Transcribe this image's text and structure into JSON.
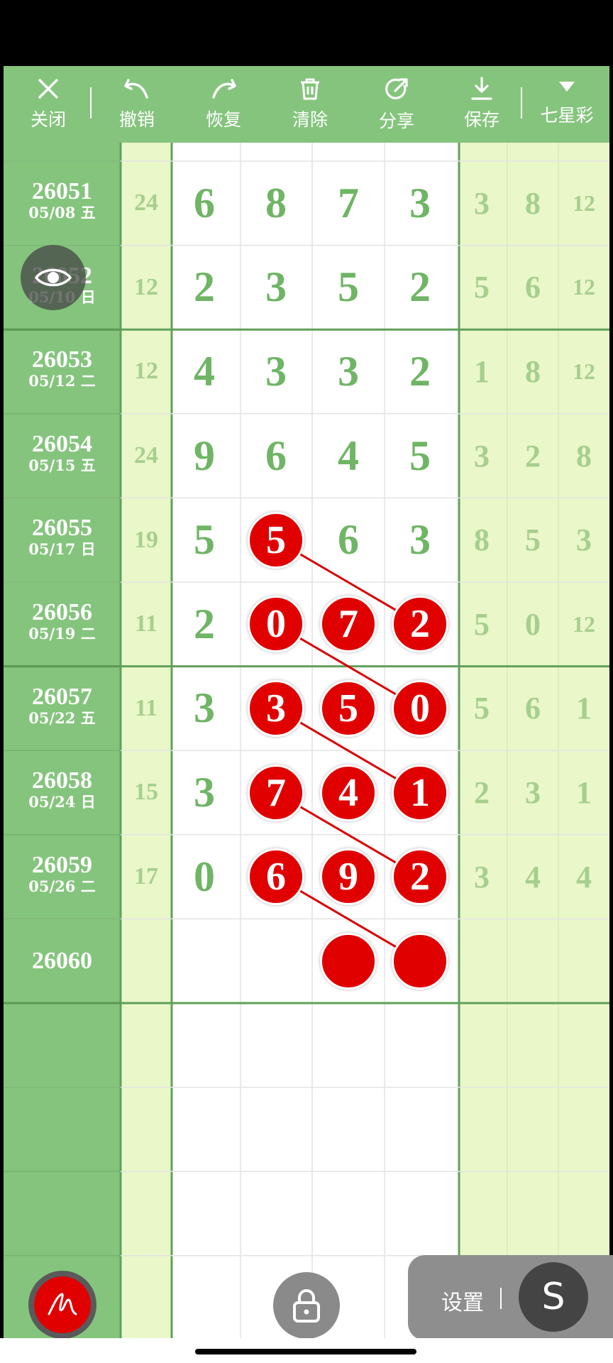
{
  "toolbar": {
    "close": "关闭",
    "undo": "撤销",
    "redo": "恢复",
    "clear": "清除",
    "share": "分享",
    "save": "保存",
    "lottery": "七星彩"
  },
  "rows": [
    {
      "issue": "26051",
      "date": "05/08 五",
      "sum": "24",
      "digits": [
        "6",
        "8",
        "7",
        "3"
      ],
      "right": [
        "3",
        "8",
        "12"
      ]
    },
    {
      "issue": "26052",
      "date": "05/10 日",
      "sum": "12",
      "digits": [
        "2",
        "3",
        "5",
        "2"
      ],
      "right": [
        "5",
        "6",
        "12"
      ]
    },
    {
      "issue": "26053",
      "date": "05/12 二",
      "sum": "12",
      "digits": [
        "4",
        "3",
        "3",
        "2"
      ],
      "right": [
        "1",
        "8",
        "12"
      ]
    },
    {
      "issue": "26054",
      "date": "05/15 五",
      "sum": "24",
      "digits": [
        "9",
        "6",
        "4",
        "5"
      ],
      "right": [
        "3",
        "2",
        "8"
      ]
    },
    {
      "issue": "26055",
      "date": "05/17 日",
      "sum": "19",
      "digits": [
        "5",
        "5",
        "6",
        "3"
      ],
      "right": [
        "8",
        "5",
        "3"
      ]
    },
    {
      "issue": "26056",
      "date": "05/19 二",
      "sum": "11",
      "digits": [
        "2",
        "0",
        "7",
        "2"
      ],
      "right": [
        "5",
        "0",
        "12"
      ]
    },
    {
      "issue": "26057",
      "date": "05/22 五",
      "sum": "11",
      "digits": [
        "3",
        "3",
        "5",
        "0"
      ],
      "right": [
        "5",
        "6",
        "1"
      ]
    },
    {
      "issue": "26058",
      "date": "05/24 日",
      "sum": "15",
      "digits": [
        "3",
        "7",
        "4",
        "1"
      ],
      "right": [
        "2",
        "3",
        "1"
      ]
    },
    {
      "issue": "26059",
      "date": "05/26 二",
      "sum": "17",
      "digits": [
        "0",
        "6",
        "9",
        "2"
      ],
      "right": [
        "3",
        "4",
        "4"
      ]
    },
    {
      "issue": "26060",
      "date": "",
      "sum": "",
      "digits": [
        "",
        "",
        "",
        ""
      ],
      "right": [
        "",
        "",
        ""
      ]
    }
  ],
  "highlighted": [
    [
      4,
      1
    ],
    [
      5,
      1
    ],
    [
      5,
      2
    ],
    [
      5,
      3
    ],
    [
      6,
      1
    ],
    [
      6,
      2
    ],
    [
      6,
      3
    ],
    [
      7,
      1
    ],
    [
      7,
      2
    ],
    [
      7,
      3
    ],
    [
      8,
      1
    ],
    [
      8,
      2
    ],
    [
      8,
      3
    ],
    [
      9,
      2
    ],
    [
      9,
      3
    ]
  ],
  "lines": [
    [
      [
        4,
        1
      ],
      [
        5,
        3
      ]
    ],
    [
      [
        5,
        1
      ],
      [
        6,
        3
      ]
    ],
    [
      [
        6,
        1
      ],
      [
        7,
        3
      ]
    ],
    [
      [
        7,
        1
      ],
      [
        8,
        3
      ]
    ],
    [
      [
        8,
        1
      ],
      [
        9,
        3
      ]
    ]
  ],
  "settings": {
    "label": "设置",
    "s_icon": "S"
  },
  "colors": {
    "green": "#85c47d",
    "light_green": "#eaf7c9",
    "digit_green": "#6fb565",
    "red": "#e00000"
  }
}
